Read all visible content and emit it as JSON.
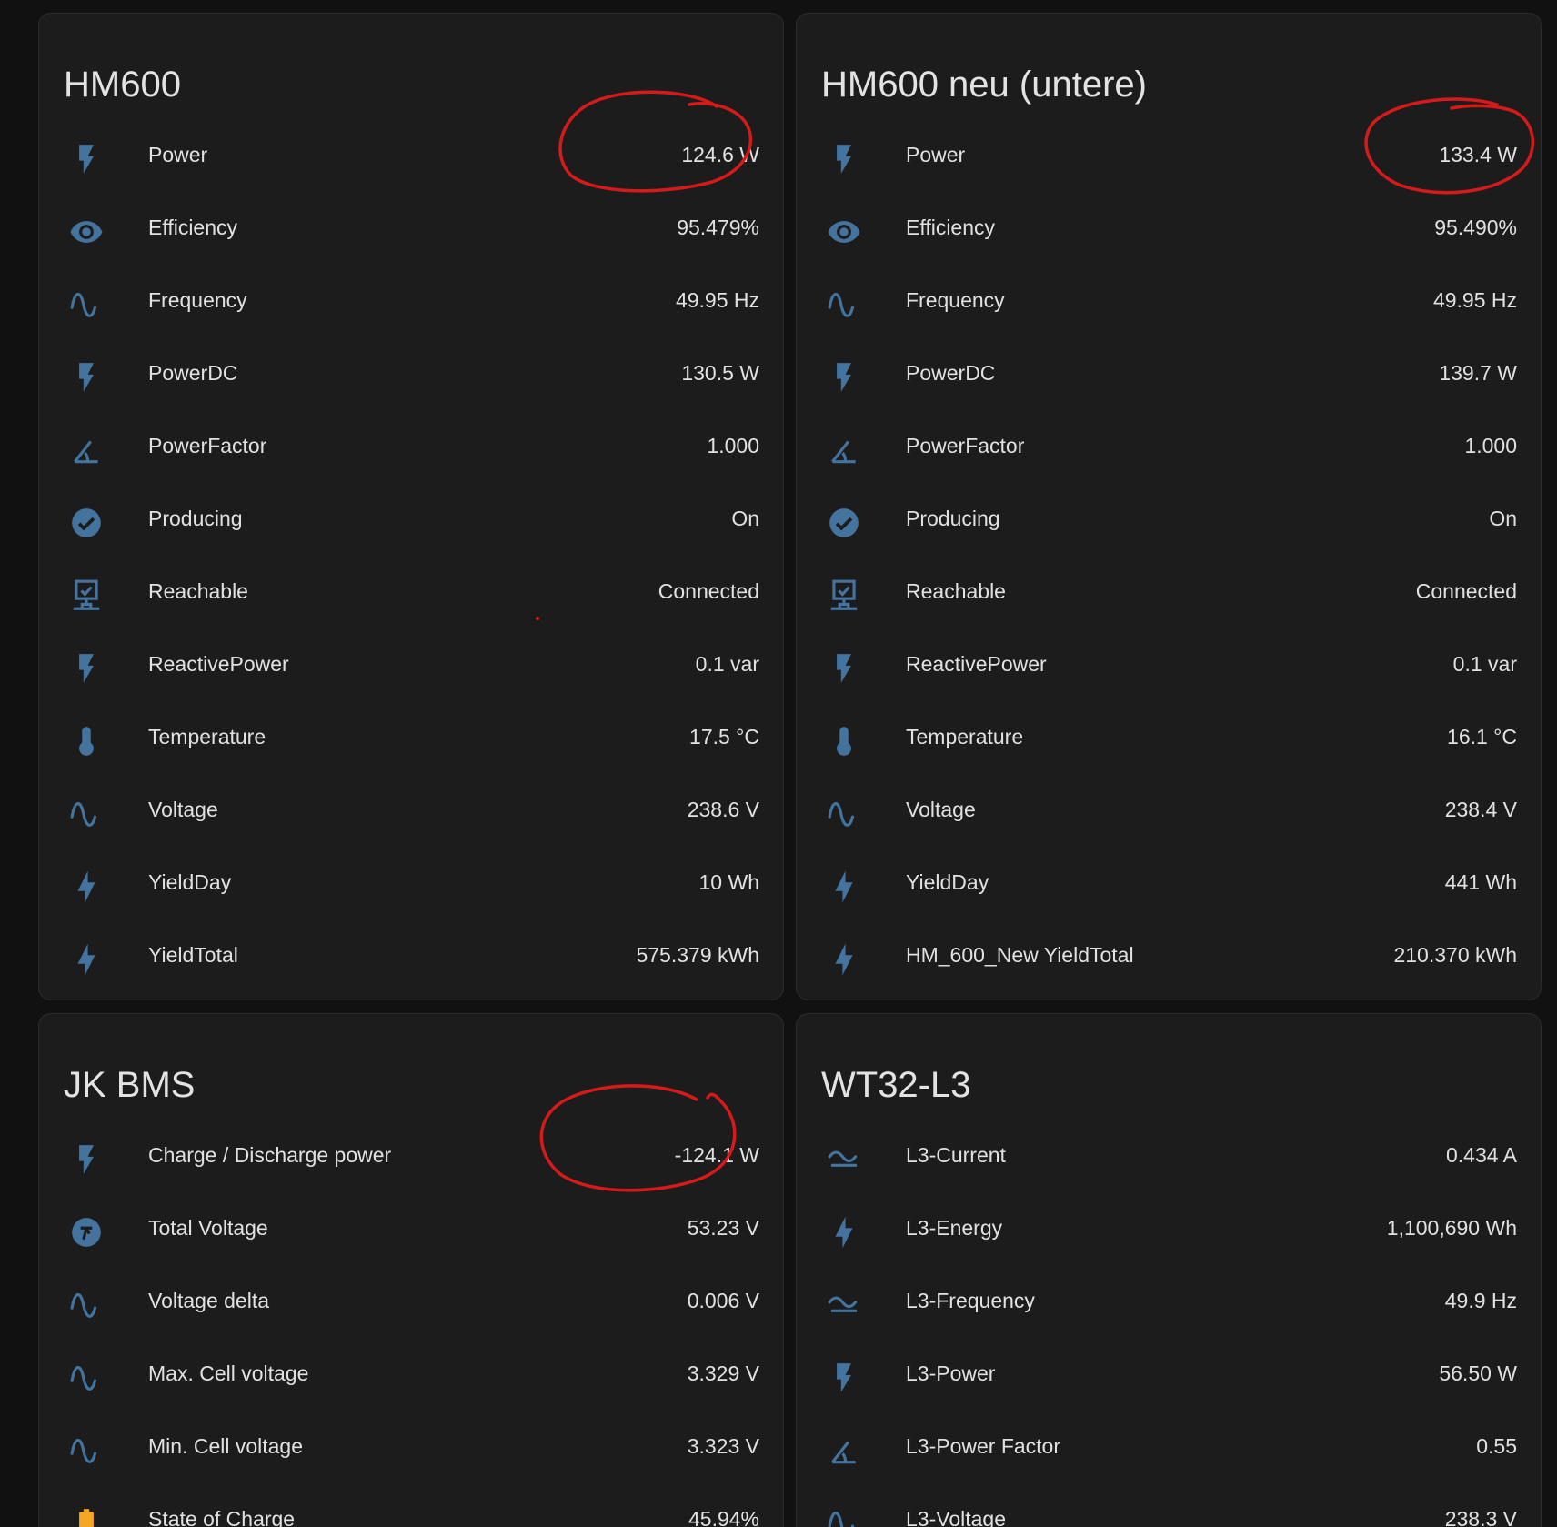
{
  "colors": {
    "background": "#111111",
    "card": "#1c1c1c",
    "icon": "#44739e",
    "battery_icon": "#f5a623",
    "text": "#e1e1e1",
    "annotation": "#d61a1a"
  },
  "cards": [
    {
      "title": "HM600",
      "rows": [
        {
          "icon": "flash-icon",
          "label": "Power",
          "value": "124.6 W"
        },
        {
          "icon": "eye-icon",
          "label": "Efficiency",
          "value": "95.479%"
        },
        {
          "icon": "sine-wave-icon",
          "label": "Frequency",
          "value": "49.95 Hz"
        },
        {
          "icon": "flash-icon",
          "label": "PowerDC",
          "value": "130.5 W"
        },
        {
          "icon": "angle-icon",
          "label": "PowerFactor",
          "value": "1.000"
        },
        {
          "icon": "check-circle-icon",
          "label": "Producing",
          "value": "On"
        },
        {
          "icon": "monitor-network-icon",
          "label": "Reachable",
          "value": "Connected"
        },
        {
          "icon": "flash-icon",
          "label": "ReactivePower",
          "value": "0.1 var"
        },
        {
          "icon": "thermometer-icon",
          "label": "Temperature",
          "value": "17.5 °C"
        },
        {
          "icon": "sine-wave-icon",
          "label": "Voltage",
          "value": "238.6 V"
        },
        {
          "icon": "lightning-icon",
          "label": "YieldDay",
          "value": "10 Wh"
        },
        {
          "icon": "lightning-icon",
          "label": "YieldTotal",
          "value": "575.379 kWh"
        }
      ]
    },
    {
      "title": "HM600 neu (untere)",
      "rows": [
        {
          "icon": "flash-icon",
          "label": "Power",
          "value": "133.4 W"
        },
        {
          "icon": "eye-icon",
          "label": "Efficiency",
          "value": "95.490%"
        },
        {
          "icon": "sine-wave-icon",
          "label": "Frequency",
          "value": "49.95 Hz"
        },
        {
          "icon": "flash-icon",
          "label": "PowerDC",
          "value": "139.7 W"
        },
        {
          "icon": "angle-icon",
          "label": "PowerFactor",
          "value": "1.000"
        },
        {
          "icon": "check-circle-icon",
          "label": "Producing",
          "value": "On"
        },
        {
          "icon": "monitor-network-icon",
          "label": "Reachable",
          "value": "Connected"
        },
        {
          "icon": "flash-icon",
          "label": "ReactivePower",
          "value": "0.1 var"
        },
        {
          "icon": "thermometer-icon",
          "label": "Temperature",
          "value": "16.1 °C"
        },
        {
          "icon": "sine-wave-icon",
          "label": "Voltage",
          "value": "238.4 V"
        },
        {
          "icon": "lightning-icon",
          "label": "YieldDay",
          "value": "441 Wh"
        },
        {
          "icon": "lightning-icon",
          "label": "HM_600_New YieldTotal",
          "value": "210.370 kWh"
        }
      ]
    },
    {
      "title": "JK BMS",
      "rows": [
        {
          "icon": "flash-icon",
          "label": "Charge / Discharge power",
          "value": "-124.1 W"
        },
        {
          "icon": "gauge-icon",
          "label": "Total Voltage",
          "value": "53.23 V"
        },
        {
          "icon": "sine-wave-icon",
          "label": "Voltage delta",
          "value": "0.006 V"
        },
        {
          "icon": "sine-wave-icon",
          "label": "Max. Cell voltage",
          "value": "3.329 V"
        },
        {
          "icon": "sine-wave-icon",
          "label": "Min. Cell voltage",
          "value": "3.323 V"
        },
        {
          "icon": "battery-icon",
          "label": "State of Charge",
          "value": "45.94%"
        }
      ]
    },
    {
      "title": "WT32-L3",
      "rows": [
        {
          "icon": "current-ac-icon",
          "label": "L3-Current",
          "value": "0.434 A"
        },
        {
          "icon": "lightning-icon",
          "label": "L3-Energy",
          "value": "1,100,690 Wh"
        },
        {
          "icon": "current-ac-icon",
          "label": "L3-Frequency",
          "value": "49.9 Hz"
        },
        {
          "icon": "flash-icon",
          "label": "L3-Power",
          "value": "56.50 W"
        },
        {
          "icon": "angle-icon",
          "label": "L3-Power Factor",
          "value": "0.55"
        },
        {
          "icon": "sine-wave-icon",
          "label": "L3-Voltage",
          "value": "238.3 V"
        }
      ]
    }
  ]
}
